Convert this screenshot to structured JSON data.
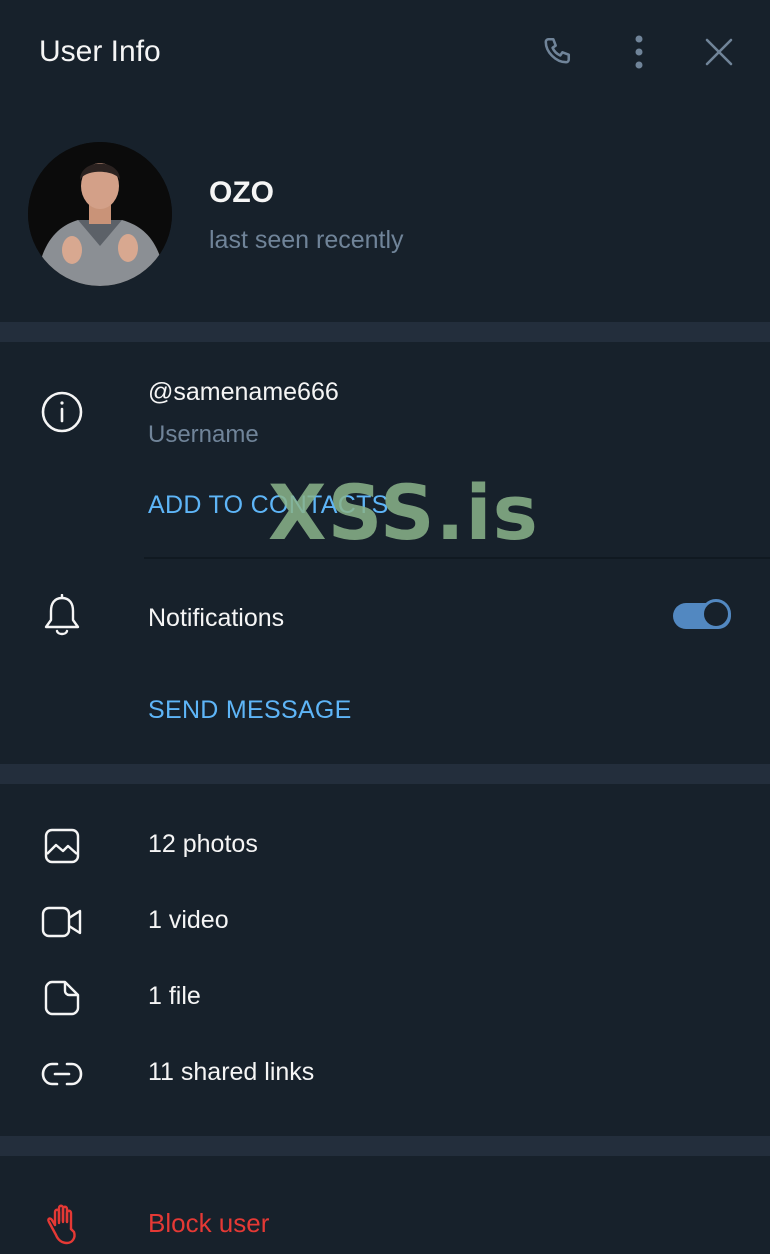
{
  "header": {
    "title": "User Info"
  },
  "profile": {
    "name": "OZO",
    "status": "last seen recently"
  },
  "info": {
    "username": "@samename666",
    "username_label": "Username",
    "add_to_contacts": "ADD TO CONTACTS",
    "notifications_label": "Notifications",
    "notifications_on": true,
    "send_message": "SEND MESSAGE"
  },
  "media": [
    {
      "label": "12 photos",
      "icon": "photo-icon"
    },
    {
      "label": "1 video",
      "icon": "video-icon"
    },
    {
      "label": "1 file",
      "icon": "file-icon"
    },
    {
      "label": "11 shared links",
      "icon": "link-icon"
    }
  ],
  "block": {
    "label": "Block user"
  },
  "watermark": "XSS.is",
  "colors": {
    "background": "#17212b",
    "separator": "#232e3c",
    "accent": "#5eb5f7",
    "toggle": "#5288c1",
    "muted": "#708499",
    "danger": "#e53935"
  }
}
